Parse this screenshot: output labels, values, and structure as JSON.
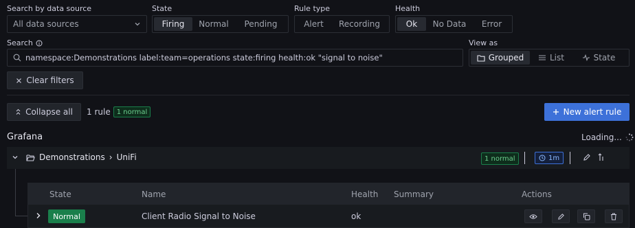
{
  "filters": {
    "datasource": {
      "label": "Search by data source",
      "value": "All data sources"
    },
    "state": {
      "label": "State",
      "options": [
        "Firing",
        "Normal",
        "Pending"
      ],
      "active": "Firing"
    },
    "rule_type": {
      "label": "Rule type",
      "options": [
        "Alert",
        "Recording"
      ]
    },
    "health": {
      "label": "Health",
      "options": [
        "Ok",
        "No Data",
        "Error"
      ],
      "active": "Ok"
    },
    "search": {
      "label": "Search",
      "value": "namespace:Demonstrations label:team=operations state:firing health:ok \"signal to noise\""
    },
    "view_as": {
      "label": "View as",
      "options": [
        "Grouped",
        "List",
        "State"
      ],
      "active": "Grouped"
    },
    "clear_label": "Clear filters"
  },
  "toolbar": {
    "collapse_label": "Collapse all",
    "rule_count": "1 rule",
    "normal_badge": "1 normal",
    "new_rule_label": "New alert rule"
  },
  "grafana": {
    "title": "Grafana",
    "loading": "Loading..."
  },
  "folder": {
    "namespace": "Demonstrations",
    "separator": "›",
    "group": "UniFi",
    "normal_badge": "1 normal",
    "interval": "1m"
  },
  "table": {
    "headers": {
      "state": "State",
      "name": "Name",
      "health": "Health",
      "summary": "Summary",
      "actions": "Actions"
    },
    "rows": [
      {
        "state": "Normal",
        "name": "Client Radio Signal to Noise",
        "health": "ok",
        "summary": ""
      }
    ]
  },
  "colors": {
    "accent": "#3d71d9",
    "normal_green": "#1a7f4b",
    "background": "#111217"
  }
}
